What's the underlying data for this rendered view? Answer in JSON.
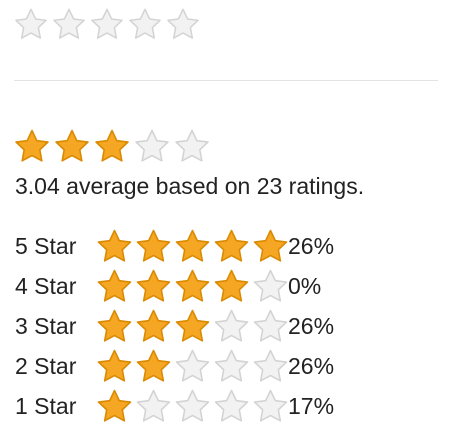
{
  "colors": {
    "filled_star": "#f5a623",
    "filled_star_edge": "#d98a00",
    "empty_star": "#f2f2f2",
    "empty_star_edge": "#d3d3d3",
    "divider": "#e3e3e3",
    "text": "#222222"
  },
  "rate_widget": {
    "icon": "star-outline-icon",
    "star_count": 5,
    "selected": 0
  },
  "average": {
    "stars_filled": 3,
    "stars_total": 5,
    "value": 3.04,
    "summary_text": "3.04 average based on 23 ratings."
  },
  "breakdown": [
    {
      "label": "5 Star",
      "stars": 5,
      "percent": "26%"
    },
    {
      "label": "4 Star",
      "stars": 4,
      "percent": "0%"
    },
    {
      "label": "3 Star",
      "stars": 3,
      "percent": "26%"
    },
    {
      "label": "2 Star",
      "stars": 2,
      "percent": "26%"
    },
    {
      "label": "1 Star",
      "stars": 1,
      "percent": "17%"
    }
  ]
}
